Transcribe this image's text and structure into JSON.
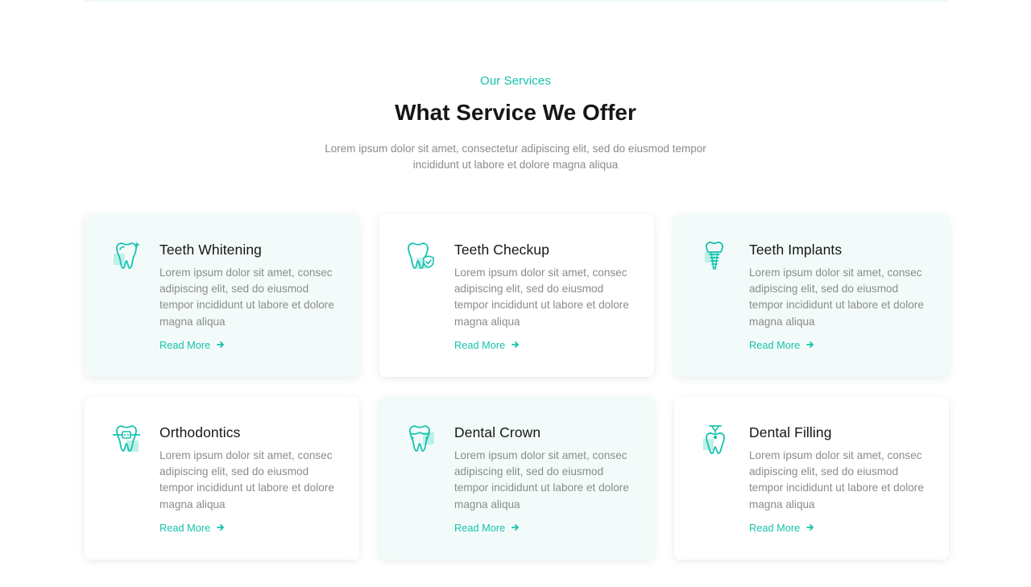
{
  "section": {
    "eyebrow": "Our Services",
    "heading": "What Service We Offer",
    "intro": "Lorem ipsum dolor sit amet, consectetur adipiscing elit, sed do eiusmod tempor incididunt ut labore et dolore magna aliqua"
  },
  "colors": {
    "accent": "#16c2ae",
    "accent_light": "#bff0e8",
    "heading": "#161616",
    "body_text": "#8b8b8b",
    "card_tint": "#f3fbfa"
  },
  "services": [
    {
      "title": "Teeth Whitening",
      "text": "Lorem ipsum dolor sit amet, consec adipiscing elit, sed do eiusmod tempor incididunt ut labore et dolore magna aliqua",
      "link": "Read More",
      "icon": "tooth-whitening-icon"
    },
    {
      "title": "Teeth Checkup",
      "text": "Lorem ipsum dolor sit amet, consec adipiscing elit, sed do eiusmod tempor incididunt ut labore et dolore magna aliqua",
      "link": "Read More",
      "icon": "tooth-checkup-icon"
    },
    {
      "title": "Teeth Implants",
      "text": "Lorem ipsum dolor sit amet, consec adipiscing elit, sed do eiusmod tempor incididunt ut labore et dolore magna aliqua",
      "link": "Read More",
      "icon": "tooth-implant-icon"
    },
    {
      "title": "Orthodontics",
      "text": "Lorem ipsum dolor sit amet, consec adipiscing elit, sed do eiusmod tempor incididunt ut labore et dolore magna aliqua",
      "link": "Read More",
      "icon": "tooth-braces-icon"
    },
    {
      "title": "Dental Crown",
      "text": "Lorem ipsum dolor sit amet, consec adipiscing elit, sed do eiusmod tempor incididunt ut labore et dolore magna aliqua",
      "link": "Read More",
      "icon": "tooth-crown-icon"
    },
    {
      "title": "Dental Filling",
      "text": "Lorem ipsum dolor sit amet, consec adipiscing elit, sed do eiusmod tempor incididunt ut labore et dolore magna aliqua",
      "link": "Read More",
      "icon": "tooth-filling-icon"
    }
  ]
}
